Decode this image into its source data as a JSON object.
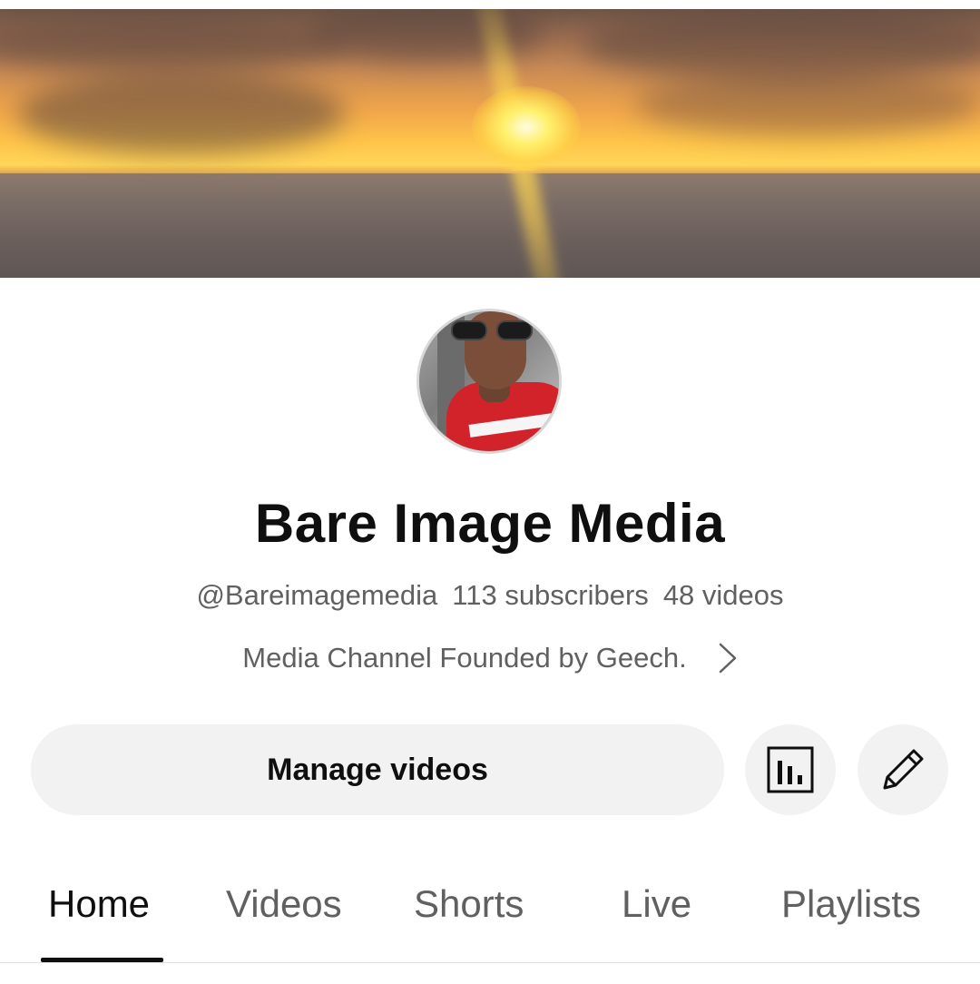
{
  "channel": {
    "name": "Bare Image Media",
    "handle": "@Bareimagemedia",
    "subscribers": "113 subscribers",
    "videos": "48 videos",
    "description": "Media Channel Founded by Geech."
  },
  "actions": {
    "manage_label": "Manage videos",
    "analytics_icon": "analytics-bar-chart-icon",
    "edit_icon": "pencil-icon"
  },
  "tabs": [
    {
      "label": "Home",
      "active": true
    },
    {
      "label": "Videos",
      "active": false
    },
    {
      "label": "Shorts",
      "active": false
    },
    {
      "label": "Live",
      "active": false
    },
    {
      "label": "Playlists",
      "active": false
    }
  ],
  "colors": {
    "text_primary": "#0f0f0f",
    "text_secondary": "#606060",
    "button_bg": "#f2f2f2"
  }
}
